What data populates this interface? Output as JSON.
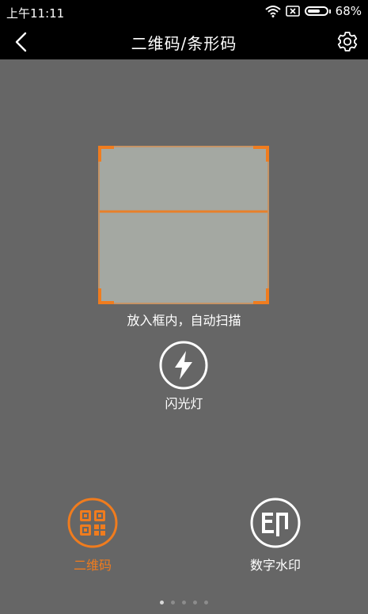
{
  "status_bar": {
    "time": "上午11:11",
    "battery": "68%",
    "battery_level": 0.68,
    "icons": [
      "wifi-icon",
      "sim-off-icon",
      "battery-icon"
    ]
  },
  "header": {
    "title": "二维码/条形码",
    "back_icon": "chevron-left-icon",
    "settings_icon": "gear-icon"
  },
  "scanner": {
    "hint": "放入框内，自动扫描"
  },
  "flashlight": {
    "label": "闪光灯",
    "icon": "lightning-icon"
  },
  "modes": [
    {
      "label": "二维码",
      "icon": "qr-code-icon",
      "active": true
    },
    {
      "label": "数字水印",
      "icon": "watermark-icon",
      "active": false
    }
  ],
  "pager": {
    "count": 5,
    "active_index": 0
  },
  "colors": {
    "accent": "#f07c1e",
    "background": "#666666",
    "bar": "#000000",
    "scan_area": "#a4a8a2"
  }
}
